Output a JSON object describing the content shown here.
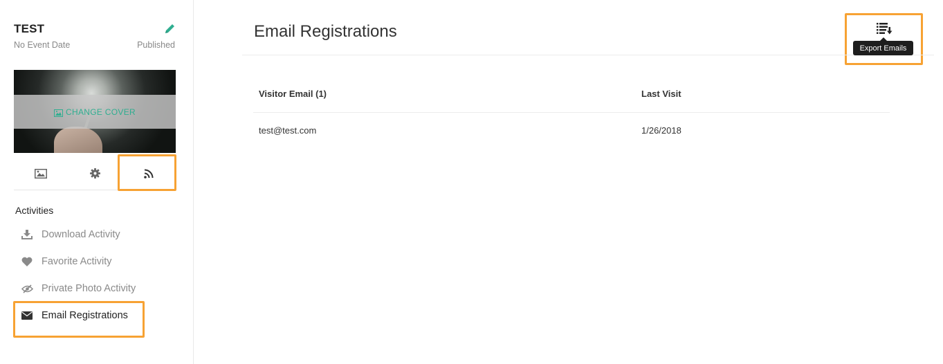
{
  "event": {
    "title": "TEST",
    "date": "No Event Date",
    "status": "Published",
    "cover_label": "CHANGE COVER"
  },
  "sidebar": {
    "tabs": [
      {
        "icon": "image-icon"
      },
      {
        "icon": "gear-icon"
      },
      {
        "icon": "rss-icon"
      }
    ],
    "section_title": "Activities",
    "items": [
      {
        "label": "Download Activity",
        "icon": "download-icon"
      },
      {
        "label": "Favorite Activity",
        "icon": "heart-icon"
      },
      {
        "label": "Private Photo Activity",
        "icon": "eye-slash-icon"
      },
      {
        "label": "Email Registrations",
        "icon": "envelope-icon",
        "active": true
      }
    ]
  },
  "main": {
    "title": "Email Registrations",
    "export_tooltip": "Export Emails",
    "table": {
      "columns": [
        "Visitor Email (1)",
        "Last Visit"
      ],
      "rows": [
        [
          "test@test.com",
          "1/26/2018"
        ]
      ]
    }
  },
  "colors": {
    "accent": "#2fae90",
    "highlight": "#f7a233",
    "tooltip_bg": "#1e1e1e"
  }
}
